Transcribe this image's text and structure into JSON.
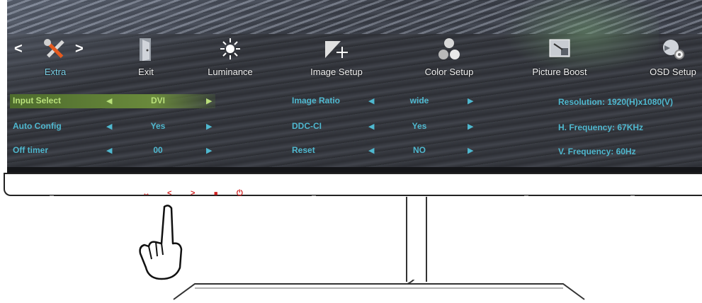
{
  "menu": {
    "items": [
      {
        "label": "Extra",
        "active": true
      },
      {
        "label": "Exit"
      },
      {
        "label": "Luminance"
      },
      {
        "label": "Image Setup"
      },
      {
        "label": "Color Setup"
      },
      {
        "label": "Picture Boost"
      },
      {
        "label": "OSD Setup"
      }
    ],
    "prev_glyph": "<",
    "next_glyph": ">"
  },
  "settings": {
    "left": [
      {
        "label": "Input Select",
        "value": "DVI",
        "selected": true
      },
      {
        "label": "Auto Config",
        "value": "Yes"
      },
      {
        "label": "Off timer",
        "value": "00"
      }
    ],
    "middle": [
      {
        "label": "Image Ratio",
        "value": "wide"
      },
      {
        "label": "DDC-CI",
        "value": "Yes"
      },
      {
        "label": "Reset",
        "value": "NO"
      }
    ],
    "info": [
      "Resolution:  1920(H)x1080(V)",
      "H. Frequency:  67KHz",
      "V. Frequency:  60Hz"
    ]
  },
  "colors": {
    "text_accent": "#4fb8cf",
    "selected_text": "#b9e07a",
    "bezel_button": "#d02020"
  },
  "icons": [
    "wrench-screwdriver-icon",
    "door-exit-icon",
    "sun-brightness-icon",
    "image-setup-icon",
    "color-balls-icon",
    "picture-boost-icon",
    "osd-gear-icon"
  ],
  "bezel_buttons": [
    {
      "icon": "source-icon",
      "glyph": "↔"
    },
    {
      "icon": "left-icon",
      "glyph": "<"
    },
    {
      "icon": "right-icon",
      "glyph": ">"
    },
    {
      "icon": "menu-icon",
      "glyph": "■"
    },
    {
      "icon": "power-icon",
      "glyph": "⏻"
    }
  ]
}
